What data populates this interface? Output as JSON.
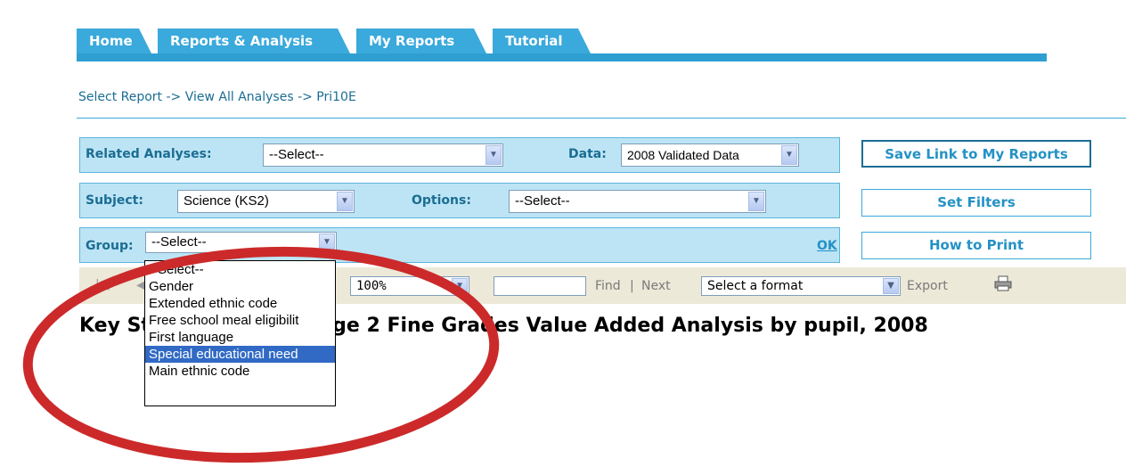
{
  "nav": {
    "tabs": [
      {
        "label": "Home"
      },
      {
        "label": "Reports & Analysis"
      },
      {
        "label": "My Reports"
      },
      {
        "label": "Tutorial"
      }
    ]
  },
  "breadcrumb": "Select Report -> View All Analyses -> Pri10E",
  "filters": {
    "related_label": "Related Analyses:",
    "related_value": "--Select--",
    "data_label": "Data:",
    "data_value": "2008 Validated Data",
    "subject_label": "Subject:",
    "subject_value": "Science (KS2)",
    "options_label": "Options:",
    "options_value": "--Select--",
    "group_label": "Group:",
    "group_value": "--Select--",
    "ok_label": "OK"
  },
  "side_buttons": {
    "save": "Save Link to My Reports",
    "filters": "Set Filters",
    "print": "How to Print"
  },
  "toolbar": {
    "zoom": "100%",
    "find": "Find",
    "separator": "|",
    "next": "Next",
    "format": "Select a format",
    "export": "Export"
  },
  "report": {
    "title": "Key Stage 1 to Key Stage 2 Fine Grades Value Added Analysis by pupil, 2008"
  },
  "dropdown": {
    "options": [
      "--Select--",
      "Gender",
      "Extended ethnic code",
      "Free school meal eligibilit",
      "First language",
      "Special educational need",
      "Main ethnic code"
    ],
    "selected_index": 5
  },
  "colors": {
    "tab": "#3aa9dc",
    "panel": "#bde4f5",
    "annotation_circle": "#cc2a2a",
    "highlight": "#316ac5"
  }
}
